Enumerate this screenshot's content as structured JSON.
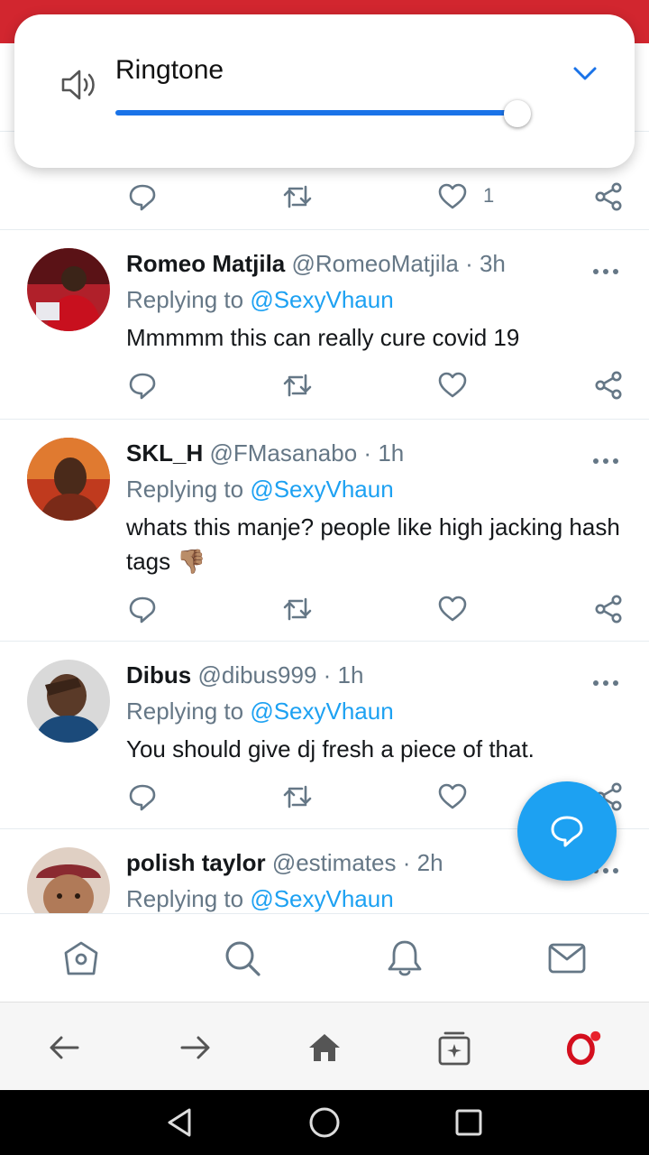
{
  "volume_popup": {
    "title": "Ringtone",
    "level_fraction": 0.93,
    "accent_color": "#1a73e8",
    "icons": [
      "speaker-icon",
      "chevron-down-icon"
    ]
  },
  "colors": {
    "status_bar": "#d2262f",
    "twitter_blue": "#1da1f2",
    "muted_text": "#657786"
  },
  "top_actions": {
    "like_count": "1"
  },
  "tweets": [
    {
      "name": "Romeo Matjila",
      "handle": "@RomeoMatjila",
      "time": "3h",
      "reply_label": "Replying to",
      "mention": "@SexyVhaun",
      "text": "Mmmmm this can really cure covid 19"
    },
    {
      "name": "SKL_H",
      "handle": "@FMasanabo",
      "time": "1h",
      "reply_label": "Replying to",
      "mention": "@SexyVhaun",
      "text": "whats this manje? people like high jacking hash tags 👎🏽"
    },
    {
      "name": "Dibus",
      "handle": "@dibus999",
      "time": "1h",
      "reply_label": "Replying to",
      "mention": "@SexyVhaun",
      "text": "You should give dj fresh a piece of that."
    },
    {
      "name": "polish taylor",
      "handle": "@estimates",
      "time": "2h",
      "reply_label": "Replying to",
      "mention": "@SexyVhaun",
      "text": ""
    }
  ],
  "separator": "·",
  "tweet_action_icons": [
    "reply-icon",
    "retweet-icon",
    "like-icon",
    "share-icon"
  ],
  "fab_icon": "compose-reply-icon",
  "twitter_nav": [
    "home-icon",
    "search-icon",
    "notifications-icon",
    "messages-icon"
  ],
  "browser_nav": [
    "back-arrow-icon",
    "forward-arrow-icon",
    "browser-home-icon",
    "tabs-icon",
    "opera-icon"
  ],
  "android_nav": [
    "back-triangle-icon",
    "home-circle-icon",
    "recents-square-icon"
  ]
}
